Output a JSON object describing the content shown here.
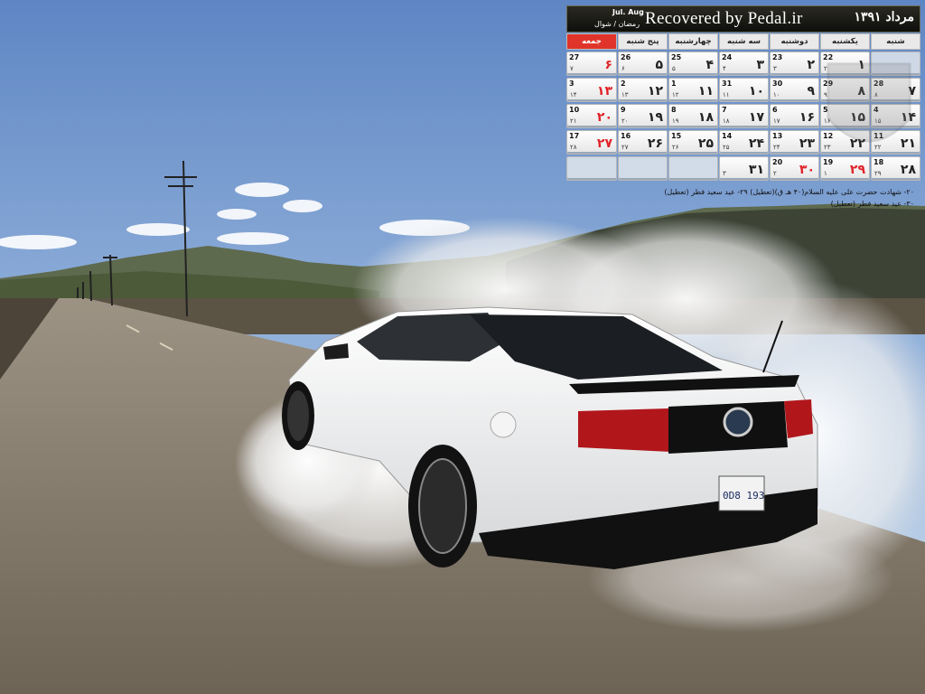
{
  "calendar": {
    "month_title": "مرداد ۱۳۹۱",
    "recovered_text": "Recovered by Pedal.ir",
    "gregorian_months": "Jul. Aug",
    "hijri_months": "رمضان / شوال",
    "weekdays": [
      "شنبه",
      "یکشنبه",
      "دوشنبه",
      "سه شنبه",
      "چهارشنبه",
      "پنج شنبه",
      "جمعه"
    ],
    "weeks": [
      [
        {
          "fa": "",
          "g": "",
          "h": ""
        },
        {
          "fa": "۱",
          "g": "22",
          "h": "۲"
        },
        {
          "fa": "۲",
          "g": "23",
          "h": "۳"
        },
        {
          "fa": "۳",
          "g": "24",
          "h": "۴"
        },
        {
          "fa": "۴",
          "g": "25",
          "h": "۵"
        },
        {
          "fa": "۵",
          "g": "26",
          "h": "۶"
        },
        {
          "fa": "۶",
          "g": "27",
          "h": "۷",
          "red": true
        }
      ],
      [
        {
          "fa": "۷",
          "g": "28",
          "h": "۸"
        },
        {
          "fa": "۸",
          "g": "29",
          "h": "۹"
        },
        {
          "fa": "۹",
          "g": "30",
          "h": "۱۰"
        },
        {
          "fa": "۱۰",
          "g": "31",
          "h": "۱۱"
        },
        {
          "fa": "۱۱",
          "g": "1",
          "h": "۱۲"
        },
        {
          "fa": "۱۲",
          "g": "2",
          "h": "۱۳"
        },
        {
          "fa": "۱۳",
          "g": "3",
          "h": "۱۴",
          "red": true
        }
      ],
      [
        {
          "fa": "۱۴",
          "g": "4",
          "h": "۱۵"
        },
        {
          "fa": "۱۵",
          "g": "5",
          "h": "۱۶"
        },
        {
          "fa": "۱۶",
          "g": "6",
          "h": "۱۷"
        },
        {
          "fa": "۱۷",
          "g": "7",
          "h": "۱۸"
        },
        {
          "fa": "۱۸",
          "g": "8",
          "h": "۱۹"
        },
        {
          "fa": "۱۹",
          "g": "9",
          "h": "۲۰"
        },
        {
          "fa": "۲۰",
          "g": "10",
          "h": "۲۱",
          "red": true
        }
      ],
      [
        {
          "fa": "۲۱",
          "g": "11",
          "h": "۲۲"
        },
        {
          "fa": "۲۲",
          "g": "12",
          "h": "۲۳"
        },
        {
          "fa": "۲۳",
          "g": "13",
          "h": "۲۴"
        },
        {
          "fa": "۲۴",
          "g": "14",
          "h": "۲۵"
        },
        {
          "fa": "۲۵",
          "g": "15",
          "h": "۲۶"
        },
        {
          "fa": "۲۶",
          "g": "16",
          "h": "۲۷"
        },
        {
          "fa": "۲۷",
          "g": "17",
          "h": "۲۸",
          "red": true
        }
      ],
      [
        {
          "fa": "۲۸",
          "g": "18",
          "h": "۲۹"
        },
        {
          "fa": "۲۹",
          "g": "19",
          "h": "۱",
          "red": true
        },
        {
          "fa": "۳۰",
          "g": "20",
          "h": "۲",
          "red": true
        },
        {
          "fa": "۳۱",
          "g": "",
          "h": "۳"
        },
        {
          "fa": "",
          "g": "",
          "h": ""
        },
        {
          "fa": "",
          "g": "",
          "h": ""
        },
        {
          "fa": "",
          "g": "",
          "h": ""
        }
      ]
    ],
    "events": [
      "۲۰- شهادت حضرت علی علیه السلام(۴۰ هـ ق)(تعطیل) ۲۹- عید سعید فطر (تعطیل)",
      "۳۰- عید سعید فطر (تعطیل)"
    ]
  },
  "wallpaper": {
    "license_plate": "0D8 193"
  },
  "colors": {
    "friday_red": "#e0342a",
    "header_dark": "#1a1a15"
  }
}
